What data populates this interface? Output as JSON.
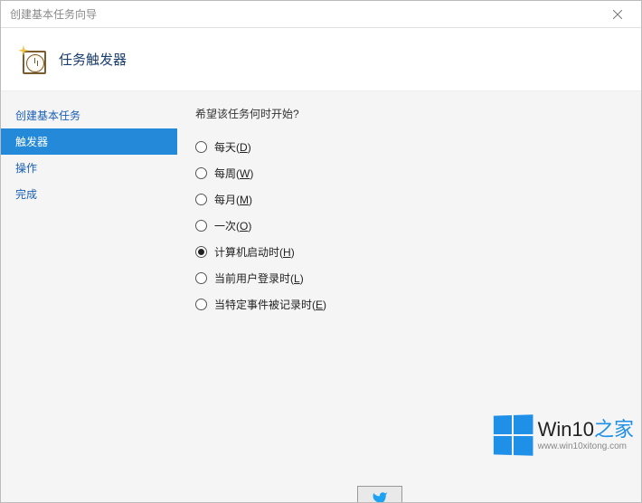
{
  "window": {
    "title": "创建基本任务向导"
  },
  "header": {
    "title": "任务触发器"
  },
  "sidebar": {
    "items": [
      {
        "label": "创建基本任务",
        "selected": false
      },
      {
        "label": "触发器",
        "selected": true
      },
      {
        "label": "操作",
        "selected": false
      },
      {
        "label": "完成",
        "selected": false
      }
    ]
  },
  "content": {
    "prompt": "希望该任务何时开始?",
    "options": [
      {
        "label": "每天",
        "accel": "D",
        "checked": false
      },
      {
        "label": "每周",
        "accel": "W",
        "checked": false
      },
      {
        "label": "每月",
        "accel": "M",
        "checked": false
      },
      {
        "label": "一次",
        "accel": "O",
        "checked": false
      },
      {
        "label": "计算机启动时",
        "accel": "H",
        "checked": true
      },
      {
        "label": "当前用户登录时",
        "accel": "L",
        "checked": false
      },
      {
        "label": "当特定事件被记录时",
        "accel": "E",
        "checked": false
      }
    ]
  },
  "watermark": {
    "brand_prefix": "Win10",
    "brand_suffix": "之家",
    "url": "www.win10xitong.com"
  }
}
